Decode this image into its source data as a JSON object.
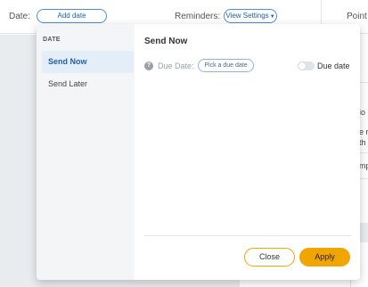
{
  "topbar": {
    "date_label": "Date:",
    "add_date_button": "Add date",
    "reminders_label": "Reminders:",
    "view_settings_button": "View Settings",
    "point_label": "Point o"
  },
  "background_fragments": {
    "line1": "io",
    "line2": "e r",
    "line3": "th",
    "line4": "mp"
  },
  "modal": {
    "sidebar": {
      "heading": "DATE",
      "items": [
        {
          "label": "Send Now",
          "active": true
        },
        {
          "label": "Send Later",
          "active": false
        }
      ]
    },
    "content": {
      "title": "Send Now",
      "due_date_label": "Due Date:",
      "pick_due_date_button": "Pick a due date",
      "toggle_label": "Due date",
      "toggle_on": false
    },
    "footer": {
      "close_button": "Close",
      "apply_button": "Apply"
    }
  },
  "colors": {
    "accent": "#f0a500",
    "link": "#1f5fa8",
    "active_bg": "#e4eef8"
  }
}
